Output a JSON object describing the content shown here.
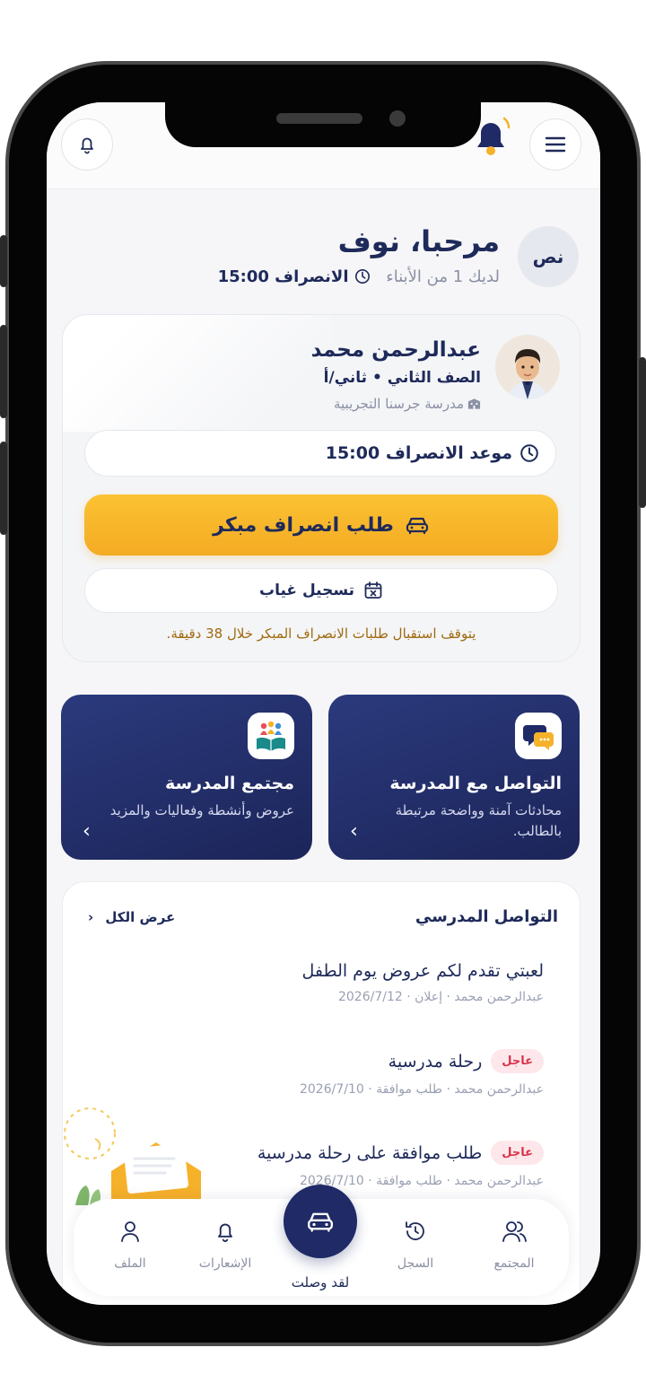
{
  "header": {
    "menu_icon": "menu-icon",
    "notification_icon": "bell-icon",
    "alert_bell_icon": "bell-ringing-icon"
  },
  "greeting": {
    "initials": "نص",
    "title": "مرحبا، نوف",
    "children_count_text": "لديك 1 من الأبناء",
    "dismissal_label": "الانصراف 15:00"
  },
  "student_card": {
    "name": "عبدالرحمن محمد",
    "grade": "الصف الثاني • ثاني/أ",
    "school": "مدرسة جرسنا التجريبية",
    "dismissal_time_label": "موعد الانصراف 15:00",
    "early_dismissal_button": "طلب انصراف مبكر",
    "absence_button": "تسجيل غياب",
    "notice": "يتوقف استقبال طلبات الانصراف المبكر خلال 38 دقيقة."
  },
  "tiles": [
    {
      "title": "التواصل مع المدرسة",
      "description": "محادثات آمنة وواضحة مرتبطة بالطالب.",
      "icon": "chat-icon"
    },
    {
      "title": "مجتمع المدرسة",
      "description": "عروض وأنشطة وفعاليات والمزيد",
      "icon": "book-community-icon"
    }
  ],
  "communication": {
    "title": "التواصل المدرسي",
    "see_all": "عرض الكل",
    "items": [
      {
        "title": "لعبتي تقدم لكم عروض يوم الطفل",
        "meta": "عبدالرحمن محمد · إعلان · 2026/7/12",
        "badge": ""
      },
      {
        "title": "رحلة مدرسية",
        "meta": "عبدالرحمن محمد · طلب موافقة · 2026/7/10",
        "badge": "عاجل"
      },
      {
        "title": "طلب موافقة على رحلة مدرسية",
        "meta": "عبدالرحمن محمد · طلب موافقة · 2026/7/10",
        "badge": "عاجل"
      }
    ]
  },
  "bottom_nav": {
    "items": [
      {
        "label": "المجتمع",
        "icon": "community-icon"
      },
      {
        "label": "السجل",
        "icon": "history-icon"
      },
      {
        "label": "الإشعارات",
        "icon": "bell-icon"
      },
      {
        "label": "الملف",
        "icon": "profile-icon"
      }
    ],
    "center_label": "لقد وصلت",
    "center_icon": "car-icon"
  },
  "colors": {
    "primary": "#1f2a66",
    "accent": "#f6b12a",
    "urgent": "#d8324a",
    "background": "#f6f6f8"
  }
}
